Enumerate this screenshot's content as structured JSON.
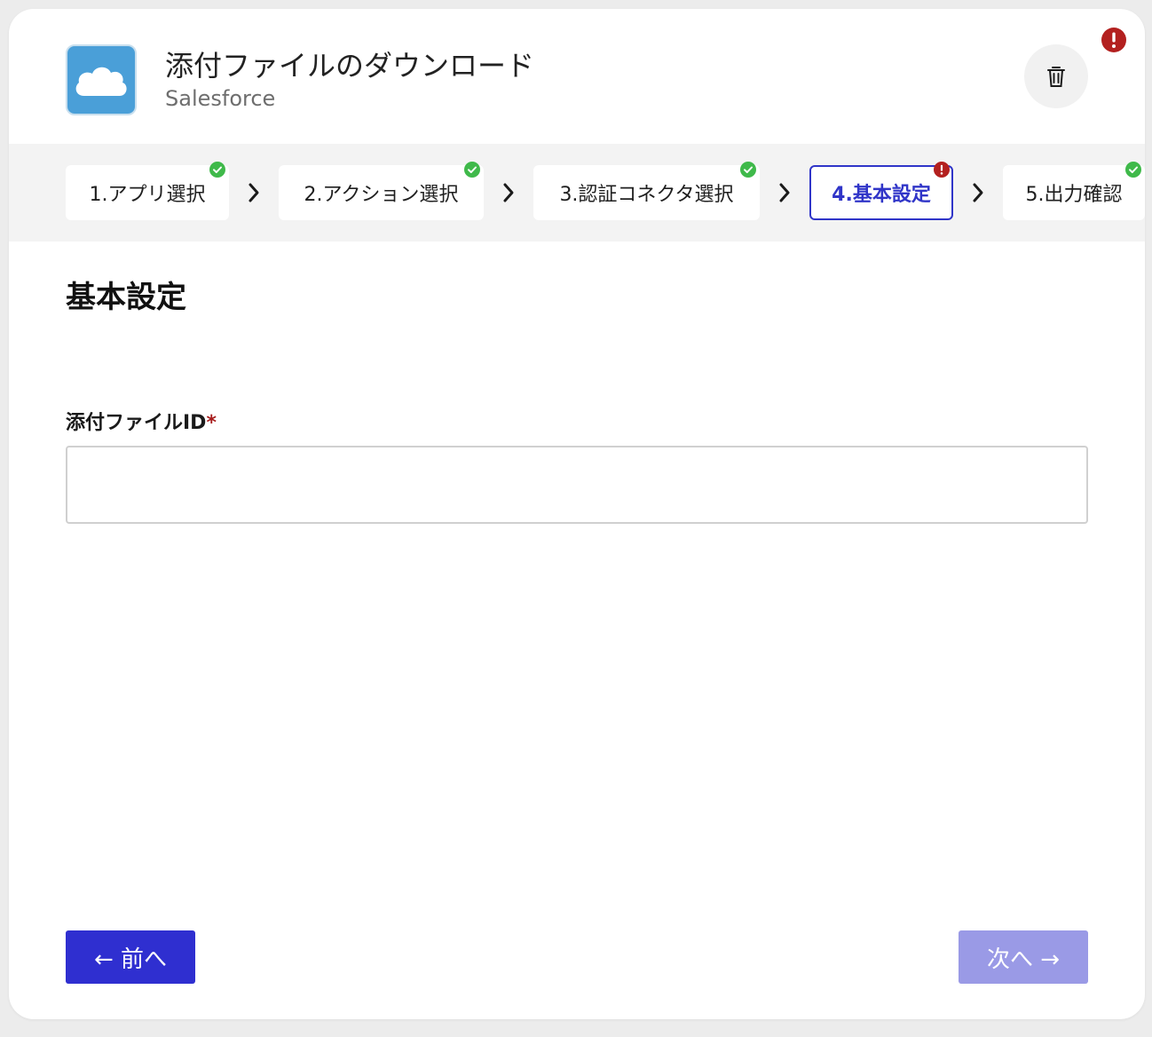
{
  "header": {
    "title": "添付ファイルのダウンロード",
    "subtitle": "Salesforce",
    "logo_icon": "cloud-icon",
    "delete_icon": "trash-icon",
    "alert_icon": "exclamation-icon"
  },
  "stepper": {
    "steps": [
      {
        "label": "1.アプリ選択",
        "status": "complete"
      },
      {
        "label": "2.アクション選択",
        "status": "complete"
      },
      {
        "label": "3.認証コネクタ選択",
        "status": "complete"
      },
      {
        "label": "4.基本設定",
        "status": "error"
      },
      {
        "label": "5.出力確認",
        "status": "complete"
      }
    ]
  },
  "main": {
    "section_title": "基本設定",
    "field_label": "添付ファイルID",
    "required_mark": "*",
    "field_value": ""
  },
  "footer": {
    "prev_label": "← 前へ",
    "next_label": "次へ →"
  },
  "colors": {
    "accent": "#2f2fd0",
    "accent_disabled": "#9a9ae6",
    "success": "#3fb94a",
    "error": "#b3201f",
    "logo": "#4a9fd8"
  }
}
